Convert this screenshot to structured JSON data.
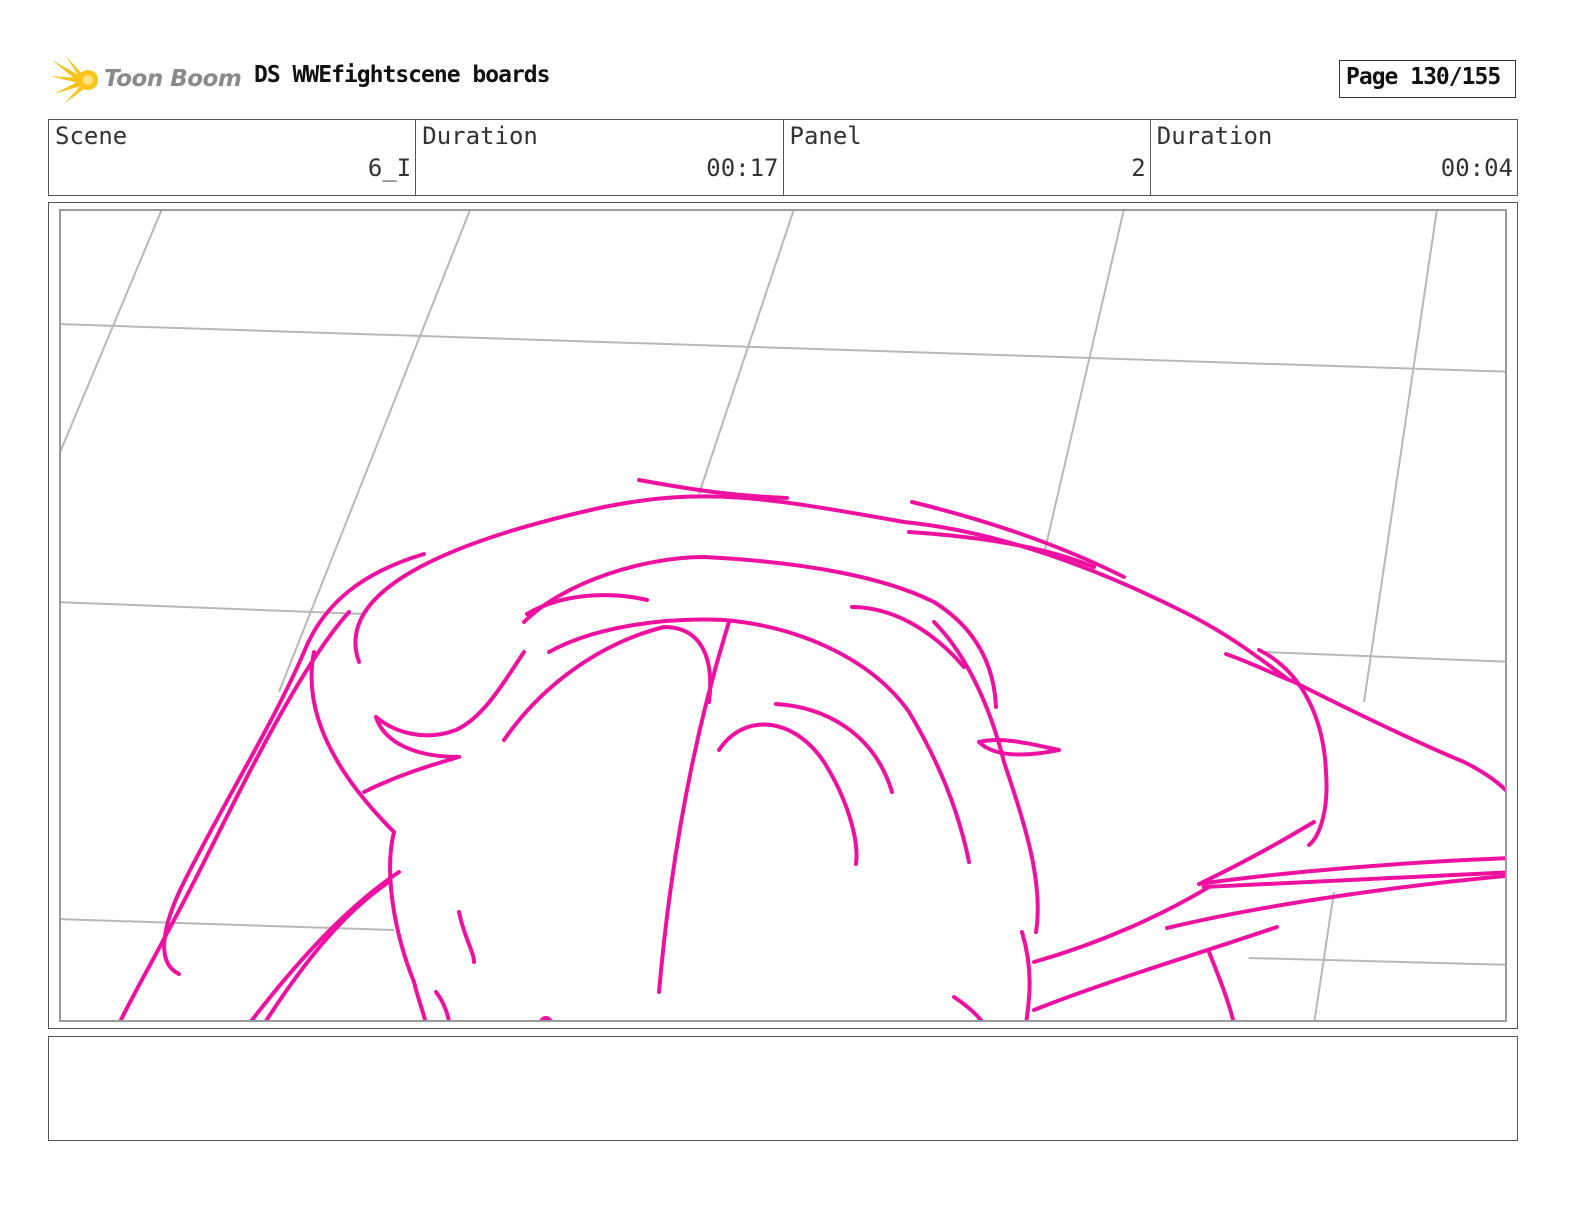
{
  "header": {
    "logo_text": "Toon Boom",
    "title": "DS WWEfightscene boards",
    "page_label": "Page 130/155"
  },
  "info": {
    "scene_label": "Scene",
    "scene_value": "6_I",
    "scene_duration_label": "Duration",
    "scene_duration_value": "00:17",
    "panel_label": "Panel",
    "panel_value": "2",
    "panel_duration_label": "Duration",
    "panel_duration_value": "00:04"
  },
  "notes": {
    "text": ""
  },
  "colors": {
    "sketch": "#ee11a0",
    "grid": "#b8b8b8",
    "logo_star": "#f7c41a"
  }
}
